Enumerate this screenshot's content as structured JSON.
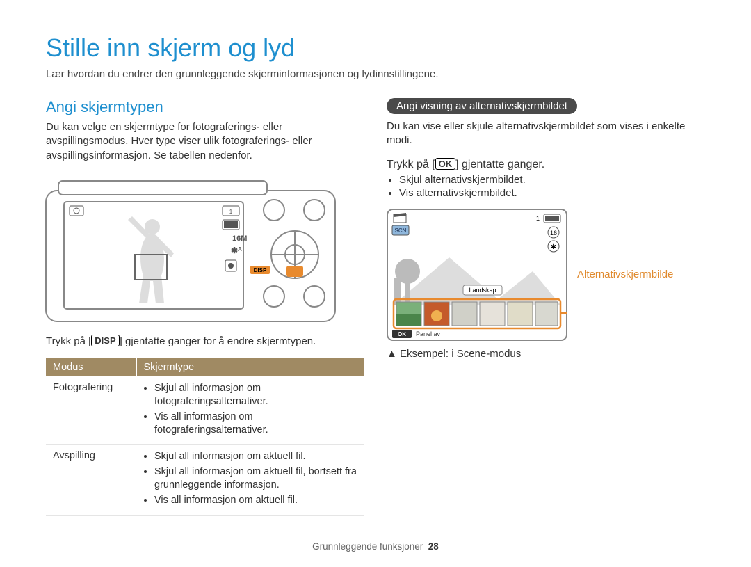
{
  "page": {
    "title": "Stille inn skjerm og lyd",
    "subtitle": "Lær hvordan du endrer den grunnleggende skjerminformasjonen og lydinnstillingene."
  },
  "left": {
    "heading": "Angi skjermtypen",
    "paragraph": "Du kan velge en skjermtype for fotograferings- eller avspillingsmodus. Hver type viser ulik fotograferings- eller avspillingsinformasjon. Se tabellen nedenfor.",
    "instruction_pre": "Trykk på [",
    "instruction_btn": "DISP",
    "instruction_post": "] gjentatte ganger for å endre skjermtypen.",
    "table": {
      "headers": {
        "c0": "Modus",
        "c1": "Skjermtype"
      },
      "rows": [
        {
          "mode": "Fotografering",
          "items": [
            "Skjul all informasjon om fotograferingsalternativer.",
            "Vis all informasjon om fotograferingsalternativer."
          ]
        },
        {
          "mode": "Avspilling",
          "items": [
            "Skjul all informasjon om aktuell fil.",
            "Skjul all informasjon om aktuell fil, bortsett fra grunnleggende informasjon.",
            "Vis all informasjon om aktuell fil."
          ]
        }
      ]
    },
    "camera_disp": "DISP"
  },
  "right": {
    "pill": "Angi visning av alternativskjermbildet",
    "paragraph": "Du kan vise eller skjule alternativskjermbildet som vises i enkelte modi.",
    "instruction_pre": "Trykk på [",
    "instruction_btn": "OK",
    "instruction_post": "] gjentatte ganger.",
    "bullets": [
      "Skjul alternativskjermbildet.",
      "Vis alternativskjermbildet."
    ],
    "diagram": {
      "scn": "SCN",
      "mode_label": "Landskap",
      "panel_btn": "OK",
      "panel_text": "Panel av"
    },
    "callout": "Alternativskjermbilde",
    "example": "▲ Eksempel: i Scene-modus"
  },
  "footer": {
    "section": "Grunnleggende funksjoner",
    "page": "28"
  }
}
